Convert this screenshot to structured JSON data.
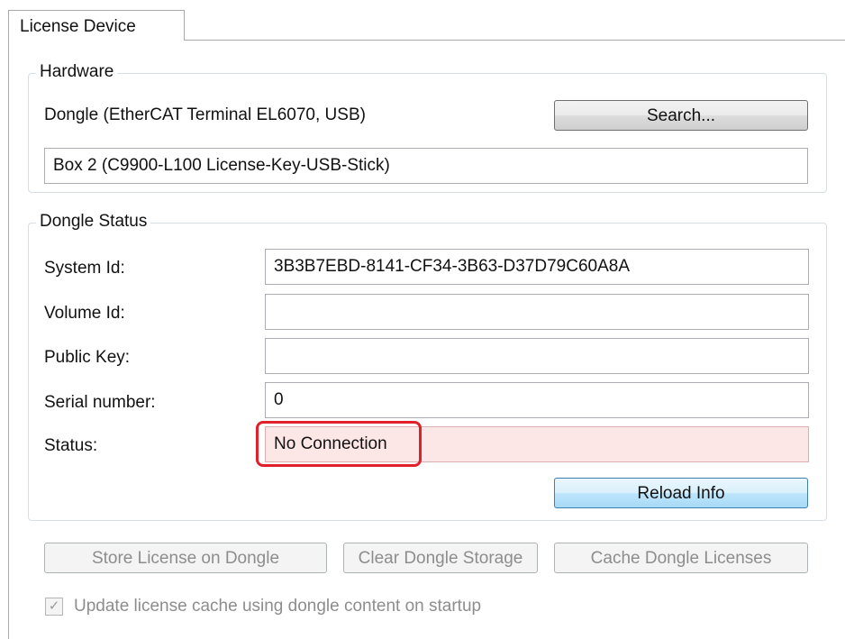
{
  "tabs": [
    {
      "label": "License Device"
    }
  ],
  "hardware": {
    "legend": "Hardware",
    "device_label": "Dongle (EtherCAT Terminal EL6070, USB)",
    "search_button": "Search...",
    "selected_device": "Box 2 (C9900-L100 License-Key-USB-Stick)"
  },
  "dongle_status": {
    "legend": "Dongle Status",
    "system_id_label": "System Id:",
    "system_id_value": "3B3B7EBD-8141-CF34-3B63-D37D79C60A8A",
    "volume_id_label": "Volume Id:",
    "volume_id_value": "",
    "public_key_label": "Public Key:",
    "public_key_value": "",
    "serial_number_label": "Serial number:",
    "serial_number_value": "0",
    "status_label": "Status:",
    "status_value": "No Connection",
    "reload_button": "Reload Info"
  },
  "actions": {
    "store_button": "Store License on Dongle",
    "clear_button": "Clear Dongle Storage",
    "cache_button": "Cache Dongle Licenses"
  },
  "options": {
    "update_cache_label": "Update license cache using dongle content on startup",
    "update_cache_checked": true,
    "check_glyph": "✓"
  },
  "colors": {
    "status_error_bg": "#fde6e6",
    "highlight": "#e0202a",
    "primary_button": "#bee6fd"
  }
}
